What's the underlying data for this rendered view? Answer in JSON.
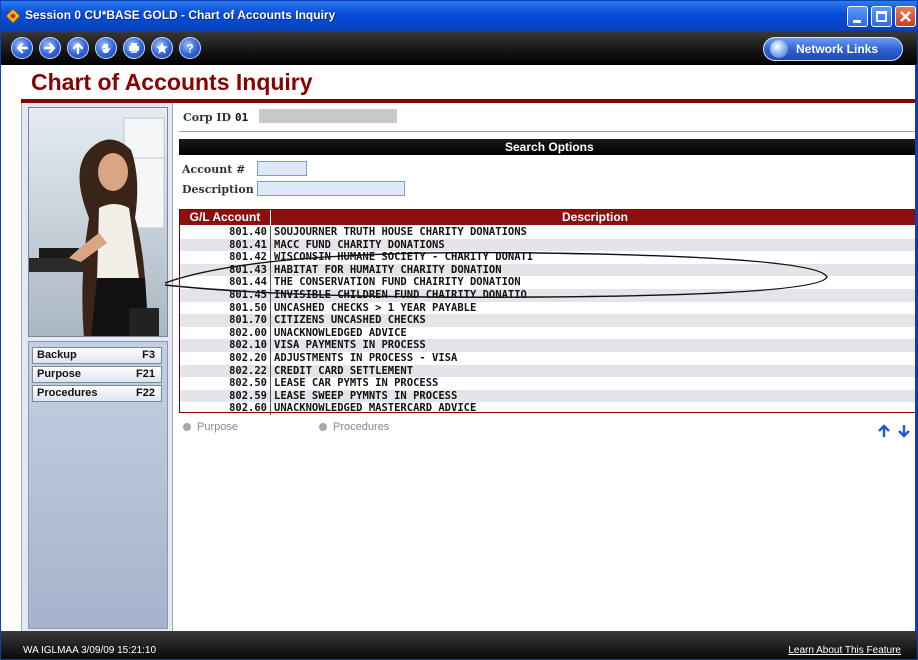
{
  "window": {
    "title": "Session 0 CU*BASE GOLD - Chart of Accounts Inquiry"
  },
  "toolbar": {
    "nav_icons": [
      "back-icon",
      "forward-icon",
      "up-icon",
      "hand-stop-icon",
      "print-icon",
      "favorites-star-icon",
      "help-icon"
    ],
    "network_links_label": "Network Links"
  },
  "page": {
    "title": "Chart of Accounts Inquiry"
  },
  "corp": {
    "label": "Corp ID",
    "value": "01"
  },
  "search": {
    "header": "Search Options",
    "account_label": "Account #",
    "account_value": "",
    "description_label": "Description",
    "description_value": ""
  },
  "sidebar": {
    "buttons": [
      {
        "label": "Backup",
        "key": "F3"
      },
      {
        "label": "Purpose",
        "key": "F21"
      },
      {
        "label": "Procedures",
        "key": "F22"
      }
    ]
  },
  "table": {
    "headers": {
      "account": "G/L Account",
      "description": "Description"
    },
    "rows": [
      {
        "account": "801.40",
        "description": "SOUJOURNER TRUTH HOUSE CHARITY DONATIONS"
      },
      {
        "account": "801.41",
        "description": "MACC FUND CHARITY DONATIONS"
      },
      {
        "account": "801.42",
        "description": "WISCONSIN HUMANE SOCIETY - CHARITY DONATI"
      },
      {
        "account": "801.43",
        "description": "HABITAT FOR HUMAITY CHARITY DONATION"
      },
      {
        "account": "801.44",
        "description": "THE CONSERVATION FUND CHAIRITY DONATION"
      },
      {
        "account": "801.45",
        "description": "INVISIBLE CHILDREN FUND CHAIRITY DONATIO"
      },
      {
        "account": "801.50",
        "description": "UNCASHED CHECKS > 1 YEAR PAYABLE"
      },
      {
        "account": "801.70",
        "description": "CITIZENS UNCASHED CHECKS"
      },
      {
        "account": "802.00",
        "description": "UNACKNOWLEDGED ADVICE"
      },
      {
        "account": "802.10",
        "description": "VISA PAYMENTS IN PROCESS"
      },
      {
        "account": "802.20",
        "description": "ADJUSTMENTS IN PROCESS - VISA"
      },
      {
        "account": "802.22",
        "description": "CREDIT CARD SETTLEMENT"
      },
      {
        "account": "802.50",
        "description": "LEASE CAR PYMTS IN PROCESS"
      },
      {
        "account": "802.59",
        "description": "LEASE SWEEP PYMNTS IN PROCESS"
      },
      {
        "account": "802.60",
        "description": "UNACKNOWLEDGED MASTERCARD ADVICE"
      }
    ]
  },
  "options": {
    "purpose": "Purpose",
    "procedures": "Procedures"
  },
  "status": {
    "text": "WA IGLMAA 3/09/09 15:21:10",
    "learn_link": "Learn About This Feature"
  },
  "colors": {
    "title_red": "#8b0000",
    "header_red": "#8b1010",
    "titlebar_blue": "#0a4fd8",
    "arrow_blue": "#1a5ad8"
  }
}
